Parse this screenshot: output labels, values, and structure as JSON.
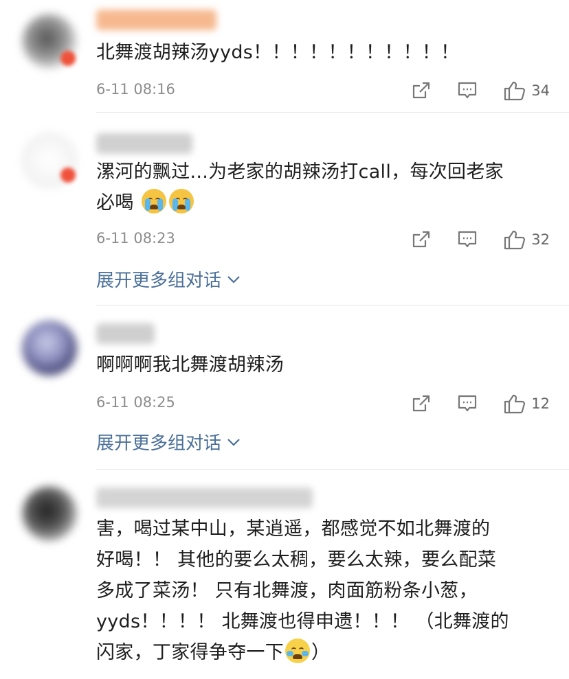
{
  "comments": [
    {
      "text": "北舞渡胡辣汤yyds！！！！！！！！！！！",
      "time": "6-11 08:16",
      "likes": "34"
    },
    {
      "text": "漯河的飘过...为老家的胡辣汤打call，每次回老家",
      "text2": "必喝",
      "emoji": "crying-emoji",
      "time": "6-11 08:23",
      "likes": "32",
      "expand": "展开更多组对话"
    },
    {
      "text": "啊啊啊我北舞渡胡辣汤",
      "time": "6-11 08:25",
      "likes": "12",
      "expand": "展开更多组对话"
    },
    {
      "lines": [
        "害，喝过某中山，某逍遥，都感觉不如北舞渡的",
        "好喝！！  其他的要么太稠，要么太辣，要么配菜",
        "多成了菜汤！ 只有北舞渡，肉面筋粉条小葱，",
        "yyds！！！！  北舞渡也得申遗！！！ （北舞渡的",
        "闪家，丁家得争夺一下"
      ],
      "tail": "）",
      "emoji": "laughing-tears-emoji"
    }
  ],
  "colors": {
    "link": "#4a6f99",
    "meta": "#8c8c8c",
    "divider": "#e6e6e6"
  }
}
